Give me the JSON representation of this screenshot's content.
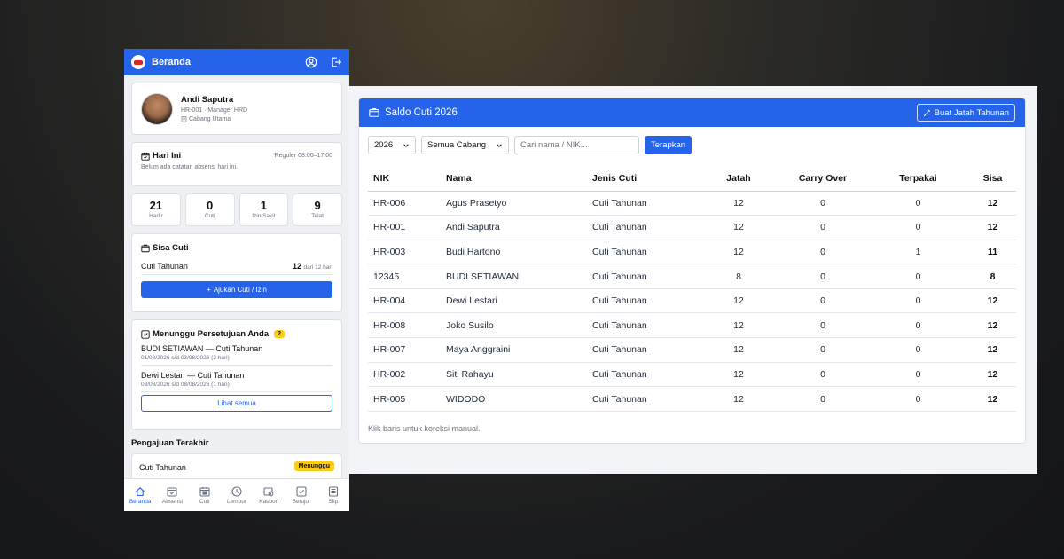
{
  "mobile": {
    "header": {
      "title": "Beranda"
    },
    "profile": {
      "name": "Andi Saputra",
      "subtitle": "HR-001 · Manager HRD",
      "branch": "Cabang Utama"
    },
    "today": {
      "title": "Hari Ini",
      "schedule": "Reguler 08:00–17:00",
      "message": "Belum ada catatan absensi hari ini."
    },
    "stats": [
      {
        "value": "21",
        "label": "Hadir"
      },
      {
        "value": "0",
        "label": "Cuti"
      },
      {
        "value": "1",
        "label": "Izin/Sakit"
      },
      {
        "value": "9",
        "label": "Telat"
      }
    ],
    "leave_balance": {
      "title": "Sisa Cuti",
      "type": "Cuti Tahunan",
      "value": "12",
      "suffix": "dari 12 hari",
      "button": "Ajukan Cuti / Izin"
    },
    "approvals": {
      "title": "Menunggu Persetujuan Anda",
      "count": "2",
      "items": [
        {
          "name": "BUDI SETIAWAN — Cuti Tahunan",
          "date": "01/08/2026 s/d 03/08/2026 (2 hari)"
        },
        {
          "name": "Dewi Lestari — Cuti Tahunan",
          "date": "08/08/2026 s/d 08/08/2026 (1 hari)"
        }
      ],
      "see_all": "Lihat semua"
    },
    "recent": {
      "title": "Pengajuan Terakhir",
      "item": "Cuti Tahunan",
      "status": "Menunggu"
    },
    "nav": [
      {
        "label": "Beranda",
        "icon": "home-icon"
      },
      {
        "label": "Absensi",
        "icon": "calendar-check-icon"
      },
      {
        "label": "Cuti",
        "icon": "calendar-icon"
      },
      {
        "label": "Lembur",
        "icon": "clock-icon"
      },
      {
        "label": "Kasbon",
        "icon": "wallet-icon"
      },
      {
        "label": "Setujui",
        "icon": "check-square-icon"
      },
      {
        "label": "Slip",
        "icon": "document-icon"
      }
    ]
  },
  "desktop": {
    "title": "Saldo Cuti 2026",
    "create_button": "Buat Jatah Tahunan",
    "filters": {
      "year": "2026",
      "branch": "Semua Cabang",
      "search_placeholder": "Cari nama / NIK...",
      "apply": "Terapkan"
    },
    "table": {
      "headers": [
        "NIK",
        "Nama",
        "Jenis Cuti",
        "Jatah",
        "Carry Over",
        "Terpakai",
        "Sisa"
      ],
      "rows": [
        [
          "HR-006",
          "Agus Prasetyo",
          "Cuti Tahunan",
          "12",
          "0",
          "0",
          "12"
        ],
        [
          "HR-001",
          "Andi Saputra",
          "Cuti Tahunan",
          "12",
          "0",
          "0",
          "12"
        ],
        [
          "HR-003",
          "Budi Hartono",
          "Cuti Tahunan",
          "12",
          "0",
          "1",
          "11"
        ],
        [
          "12345",
          "BUDI SETIAWAN",
          "Cuti Tahunan",
          "8",
          "0",
          "0",
          "8"
        ],
        [
          "HR-004",
          "Dewi Lestari",
          "Cuti Tahunan",
          "12",
          "0",
          "0",
          "12"
        ],
        [
          "HR-008",
          "Joko Susilo",
          "Cuti Tahunan",
          "12",
          "0",
          "0",
          "12"
        ],
        [
          "HR-007",
          "Maya Anggraini",
          "Cuti Tahunan",
          "12",
          "0",
          "0",
          "12"
        ],
        [
          "HR-002",
          "Siti Rahayu",
          "Cuti Tahunan",
          "12",
          "0",
          "0",
          "12"
        ],
        [
          "HR-005",
          "WIDODO",
          "Cuti Tahunan",
          "12",
          "0",
          "0",
          "12"
        ]
      ]
    },
    "footer_note": "Klik baris untuk koreksi manual."
  },
  "colors": {
    "primary": "#2563eb",
    "badge": "#facc15"
  }
}
